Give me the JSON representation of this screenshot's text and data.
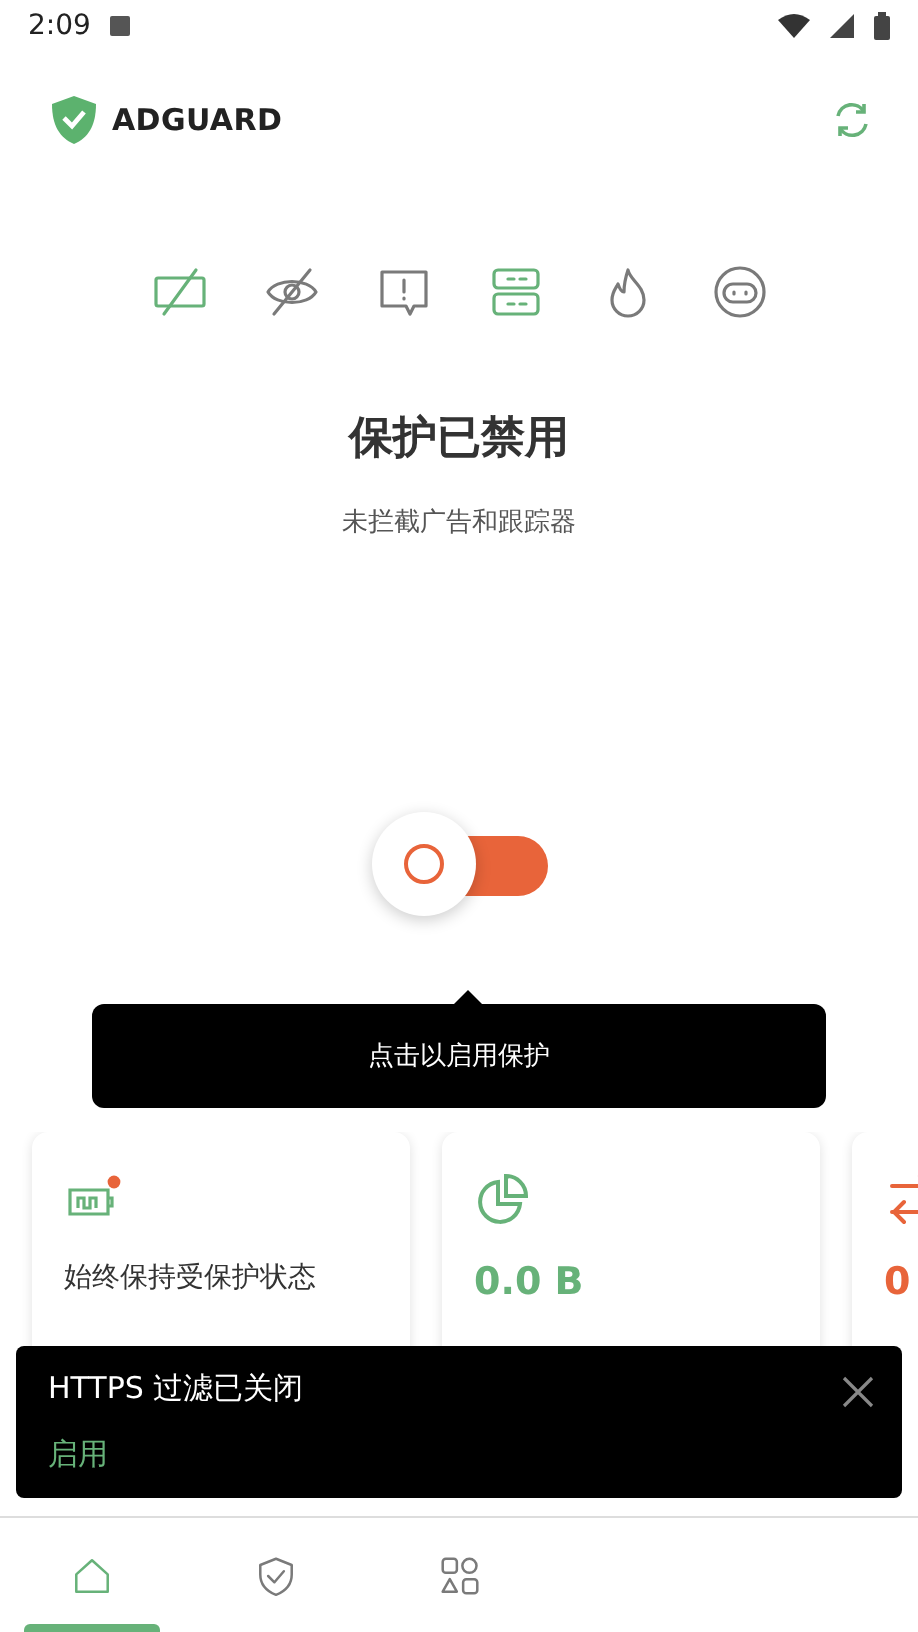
{
  "status_bar": {
    "time": "2:09"
  },
  "header": {
    "app_name": "ADGUARD"
  },
  "features": [
    {
      "active": true
    },
    {
      "active": false
    },
    {
      "active": false
    },
    {
      "active": true
    },
    {
      "active": false
    },
    {
      "active": false
    }
  ],
  "protection": {
    "title": "保护已禁用",
    "subtitle": "未拦截广告和跟踪器",
    "on": false
  },
  "tooltip": {
    "text": "点击以启用保护"
  },
  "cards": [
    {
      "kind": "text",
      "text": "始终保持受保护状态"
    },
    {
      "kind": "stat",
      "value": "0.0 B",
      "color": "#67b279"
    },
    {
      "kind": "stat",
      "value": "0",
      "color": "#e8643a"
    }
  ],
  "snackbar": {
    "message": "HTTPS 过滤已关闭",
    "action": "启用"
  },
  "nav": [
    {
      "selected": true
    },
    {
      "selected": false
    },
    {
      "selected": false
    }
  ]
}
